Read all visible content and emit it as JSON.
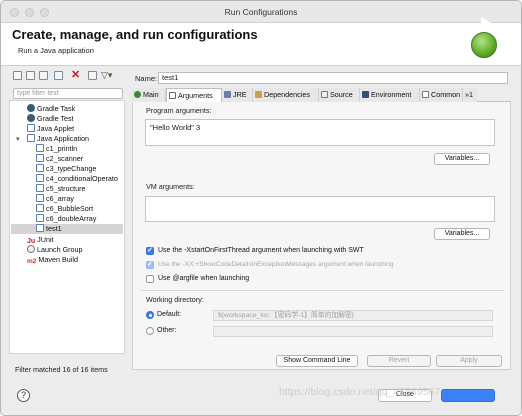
{
  "window": {
    "title": "Run Configurations"
  },
  "header": {
    "title": "Create, manage, and run configurations",
    "subtitle": "Run a Java application"
  },
  "left_panel": {
    "filter_placeholder": "type filter text",
    "tree": [
      {
        "label": "Gradle Task",
        "icon": "gradle-icon"
      },
      {
        "label": "Gradle Test",
        "icon": "gradle-icon"
      },
      {
        "label": "Java Applet",
        "icon": "java-applet-icon"
      },
      {
        "label": "Java Application",
        "icon": "java-application-icon",
        "expanded": true
      },
      {
        "label": "c1_println",
        "icon": "java-config-icon"
      },
      {
        "label": "c2_scanner",
        "icon": "java-config-icon"
      },
      {
        "label": "c3_typeChange",
        "icon": "java-config-icon"
      },
      {
        "label": "c4_conditionalOperato",
        "icon": "java-config-icon"
      },
      {
        "label": "c5_structure",
        "icon": "java-config-icon"
      },
      {
        "label": "c6_array",
        "icon": "java-config-icon"
      },
      {
        "label": "c6_BubbleSort",
        "icon": "java-config-icon"
      },
      {
        "label": "c6_doubleArray",
        "icon": "java-config-icon"
      },
      {
        "label": "test1",
        "icon": "java-config-icon",
        "selected": true
      },
      {
        "label": "JUnit",
        "icon": "junit-icon"
      },
      {
        "label": "Launch Group",
        "icon": "launch-group-icon"
      },
      {
        "label": "Maven Build",
        "icon": "maven-icon"
      }
    ],
    "status": "Filter matched 16 of 16 items"
  },
  "right_panel": {
    "name_label": "Name:",
    "name_value": "test1",
    "tabs": [
      {
        "label": "Main",
        "icon": "main-tab-icon"
      },
      {
        "label": "Arguments",
        "icon": "arguments-tab-icon",
        "active": true
      },
      {
        "label": "JRE",
        "icon": "jre-tab-icon"
      },
      {
        "label": "Dependencies",
        "icon": "dependencies-tab-icon"
      },
      {
        "label": "Source",
        "icon": "source-tab-icon"
      },
      {
        "label": "Environment",
        "icon": "environment-tab-icon"
      },
      {
        "label": "Common",
        "icon": "common-tab-icon"
      },
      {
        "label": "»1",
        "icon": ""
      }
    ],
    "program_args_label": "Program arguments:",
    "program_args_value": "\"Hello World\" 3",
    "variables_button": "Variables...",
    "vm_args_label": "VM arguments:",
    "vm_args_value": "",
    "vm_variables_button": "Variables...",
    "checkboxes": [
      {
        "label": "Use the -XstartOnFirstThread argument when launching with SWT",
        "checked": true,
        "enabled": true
      },
      {
        "label": "Use the -XX:+ShowCodeDetailsInExceptionMessages argument when launching",
        "checked": true,
        "enabled": false
      },
      {
        "label": "Use @argfile when launching",
        "checked": false,
        "enabled": true
      }
    ],
    "working_dir_label": "Working directory:",
    "default_label": "Default:",
    "default_value": "${workspace_loc:【密码学-1】简单的加解密}",
    "other_label": "Other:",
    "show_command_line": "Show Command Line",
    "revert": "Revert",
    "apply": "Apply"
  },
  "bottom": {
    "help": "?",
    "close": "Close",
    "watermark": "https://blog.csdn.net/qq_46569567"
  },
  "colors": {
    "accent": "#3b82f6",
    "run_green": "#5fa826",
    "delete_red": "#c91d1d"
  }
}
